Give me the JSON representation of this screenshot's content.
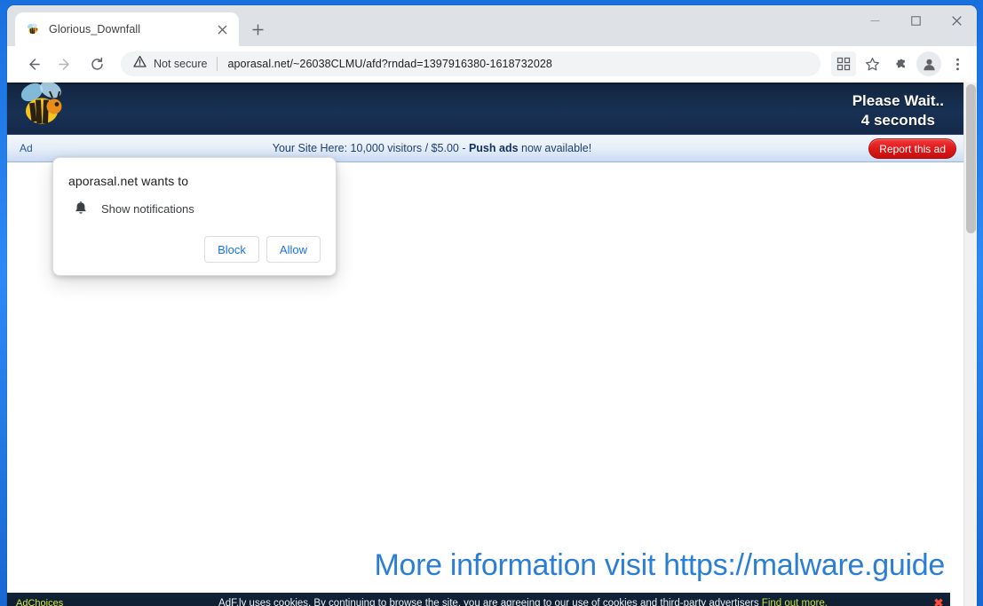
{
  "browser": {
    "tab": {
      "title": "Glorious_Downfall",
      "favicon_name": "bee-favicon",
      "close_label": "×"
    },
    "new_tab_label": "+",
    "window_controls": {
      "minimize": "—",
      "maximize": "❑",
      "close": "×"
    },
    "nav": {
      "back": "←",
      "forward": "→",
      "reload": "↻"
    },
    "omnibox": {
      "security_label": "Not secure",
      "url": "aporasal.net/~26038CLMU/afd?rndad=1397916380-1618732028"
    },
    "toolbar_icons": [
      {
        "name": "qr-code-icon",
        "glyph": "∷"
      },
      {
        "name": "bookmark-star-icon",
        "glyph": "☆"
      },
      {
        "name": "extensions-puzzle-icon",
        "glyph": "❖"
      },
      {
        "name": "profile-avatar-icon",
        "glyph": "●"
      },
      {
        "name": "chrome-menu-icon",
        "glyph": "⋮"
      }
    ]
  },
  "permission_popup": {
    "origin_text": "aporasal.net wants to",
    "permission_label": "Show notifications",
    "icon_name": "bell-icon",
    "block_label": "Block",
    "allow_label": "Allow"
  },
  "site": {
    "header": {
      "logo_name": "adfly-bee-logo",
      "wait_line1": "Please Wait..",
      "wait_line2": "4 seconds"
    },
    "ad_bar": {
      "left_label": "Ad",
      "text_prefix": "Your Site Here: 10,000 visitors / $5.00 - ",
      "text_bold": "Push ads",
      "text_suffix": " now available!",
      "report_label": "Report this ad"
    },
    "watermark_text": "More information visit https://malware.guide",
    "cookie_bar": {
      "adchoices_label": "AdChoices",
      "text": "AdF.ly uses cookies. By continuing to browse the site, you are agreeing to our use of cookies and third-party advertisers ",
      "link_label": "Find out more.",
      "close_glyph": "✖"
    }
  },
  "colors": {
    "site_header_navy": "#16294a",
    "report_ad_red": "#e01b1b",
    "adchoices_yellow": "#d7ea3a",
    "watermark_blue": "#2a7fd4",
    "chrome_link_blue": "#1a73e8",
    "desktop_blue": "#1f7ef0"
  }
}
